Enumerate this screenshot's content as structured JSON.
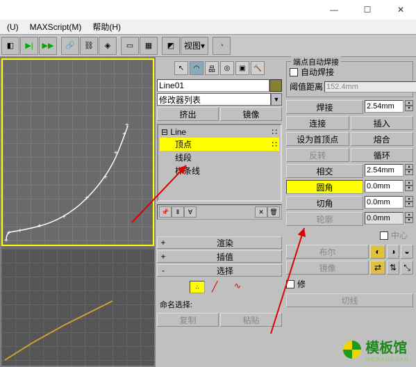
{
  "menu": {
    "u": "(U)",
    "maxscript": "MAXScript(M)",
    "help": "帮助(H)"
  },
  "toolbar": {
    "view_label": "视图"
  },
  "mid": {
    "object_name": "Line01",
    "modifier_placeholder": "修改器列表",
    "extrude": "挤出",
    "mirror": "镜像",
    "tree_root": "Line",
    "tree_items": [
      "顶点",
      "线段",
      "样条线"
    ],
    "render": "渲染",
    "interpolate": "插值",
    "select": "选择",
    "naming_label": "命名选择:",
    "copy": "复制",
    "paste": "粘贴"
  },
  "right": {
    "group_weld_title": "端点自动焊接",
    "auto_weld": "自动焊接",
    "threshold": "阈值距离",
    "threshold_val": "152.4mm",
    "weld": "焊接",
    "weld_val": "2.54mm",
    "connect": "连接",
    "insert": "插入",
    "make_first": "设为首顶点",
    "fuse": "熔合",
    "reverse": "反转",
    "cycle": "循环",
    "cross": "相交",
    "cross_val": "2.54mm",
    "fillet": "圆角",
    "fillet_val": "0.0mm",
    "chamfer": "切角",
    "chamfer_val": "0.0mm",
    "outline": "轮廓",
    "outline_val": "0.0mm",
    "center": "中心",
    "boolean": "布尔",
    "mirror2": "镜像",
    "trim": "修",
    "cut": "切线"
  },
  "watermark": {
    "text1": "模板馆",
    "text2": "MOBANGUAN"
  }
}
